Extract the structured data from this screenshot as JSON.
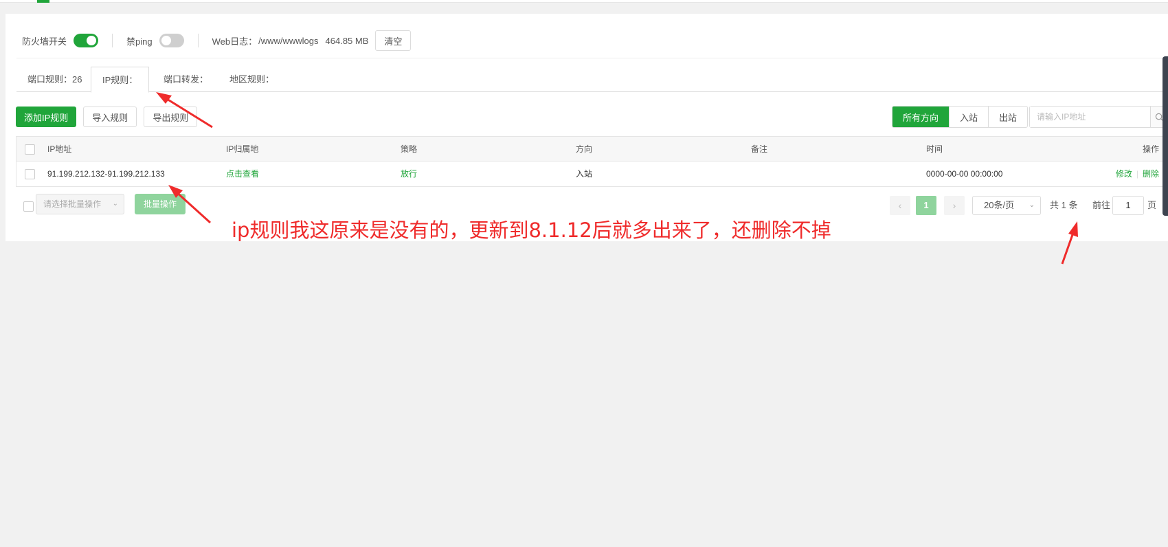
{
  "settings": {
    "firewall_label": "防火墙开关",
    "firewall_on": true,
    "ping_label": "禁ping",
    "ping_on": false,
    "weblog_label": "Web日志：",
    "weblog_path": "/www/wwwlogs",
    "weblog_size": "464.85 MB",
    "clear_label": "清空"
  },
  "tabs": [
    {
      "label": "端口规则：26"
    },
    {
      "label": "IP规则："
    },
    {
      "label": "端口转发："
    },
    {
      "label": "地区规则："
    }
  ],
  "active_tab": 1,
  "toolbar": {
    "add_label": "添加IP规则",
    "import_label": "导入规则",
    "export_label": "导出规则"
  },
  "direction": {
    "all": "所有方向",
    "in": "入站",
    "out": "出站"
  },
  "search": {
    "placeholder": "请输入IP地址"
  },
  "table": {
    "headers": {
      "ip": "IP地址",
      "location": "IP归属地",
      "policy": "策略",
      "direction": "方向",
      "remark": "备注",
      "time": "时间",
      "ops": "操作"
    },
    "rows": [
      {
        "ip": "91.199.212.132-91.199.212.133",
        "location": "点击查看",
        "policy": "放行",
        "direction": "入站",
        "remark": "",
        "time": "0000-00-00 00:00:00",
        "edit": "修改",
        "delete": "删除"
      }
    ]
  },
  "footer": {
    "batch_placeholder": "请选择批量操作",
    "batch_button": "批量操作"
  },
  "pagination": {
    "current": "1",
    "page_size": "20条/页",
    "total": "共 1 条",
    "goto_prefix": "前往",
    "goto_value": "1",
    "goto_suffix": "页"
  },
  "annotation": {
    "text": "ip规则我这原来是没有的，更新到8.1.12后就多出来了，还删除不掉"
  },
  "colors": {
    "accent": "#20a53a",
    "annotation": "#ef2b2b"
  }
}
